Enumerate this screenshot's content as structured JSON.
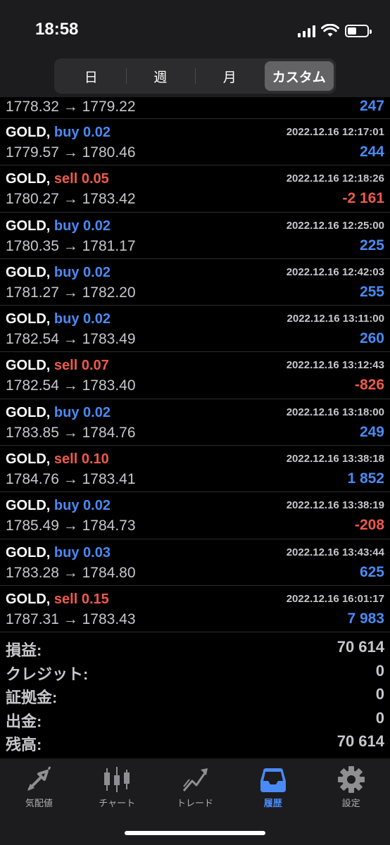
{
  "status_bar": {
    "time": "18:58"
  },
  "period_tabs": [
    "日",
    "週",
    "月",
    "カスタム"
  ],
  "trades": [
    {
      "symbol": "",
      "side": "",
      "volume": "",
      "time": "",
      "open": "1778.32",
      "close": "1779.22",
      "profit": "247",
      "profit_sign": "pos",
      "partial": true
    },
    {
      "symbol": "GOLD,",
      "side": "buy",
      "volume": "0.02",
      "time": "2022.12.16 12:17:01",
      "open": "1779.57",
      "close": "1780.46",
      "profit": "244",
      "profit_sign": "pos"
    },
    {
      "symbol": "GOLD,",
      "side": "sell",
      "volume": "0.05",
      "time": "2022.12.16 12:18:26",
      "open": "1780.27",
      "close": "1783.42",
      "profit": "-2 161",
      "profit_sign": "neg"
    },
    {
      "symbol": "GOLD,",
      "side": "buy",
      "volume": "0.02",
      "time": "2022.12.16 12:25:00",
      "open": "1780.35",
      "close": "1781.17",
      "profit": "225",
      "profit_sign": "pos"
    },
    {
      "symbol": "GOLD,",
      "side": "buy",
      "volume": "0.02",
      "time": "2022.12.16 12:42:03",
      "open": "1781.27",
      "close": "1782.20",
      "profit": "255",
      "profit_sign": "pos"
    },
    {
      "symbol": "GOLD,",
      "side": "buy",
      "volume": "0.02",
      "time": "2022.12.16 13:11:00",
      "open": "1782.54",
      "close": "1783.49",
      "profit": "260",
      "profit_sign": "pos"
    },
    {
      "symbol": "GOLD,",
      "side": "sell",
      "volume": "0.07",
      "time": "2022.12.16 13:12:43",
      "open": "1782.54",
      "close": "1783.40",
      "profit": "-826",
      "profit_sign": "neg"
    },
    {
      "symbol": "GOLD,",
      "side": "buy",
      "volume": "0.02",
      "time": "2022.12.16 13:18:00",
      "open": "1783.85",
      "close": "1784.76",
      "profit": "249",
      "profit_sign": "pos"
    },
    {
      "symbol": "GOLD,",
      "side": "sell",
      "volume": "0.10",
      "time": "2022.12.16 13:38:18",
      "open": "1784.76",
      "close": "1783.41",
      "profit": "1 852",
      "profit_sign": "pos"
    },
    {
      "symbol": "GOLD,",
      "side": "buy",
      "volume": "0.02",
      "time": "2022.12.16 13:38:19",
      "open": "1785.49",
      "close": "1784.73",
      "profit": "-208",
      "profit_sign": "neg"
    },
    {
      "symbol": "GOLD,",
      "side": "buy",
      "volume": "0.03",
      "time": "2022.12.16 13:43:44",
      "open": "1783.28",
      "close": "1784.80",
      "profit": "625",
      "profit_sign": "pos"
    },
    {
      "symbol": "GOLD,",
      "side": "sell",
      "volume": "0.15",
      "time": "2022.12.16 16:01:17",
      "open": "1787.31",
      "close": "1783.43",
      "profit": "7 983",
      "profit_sign": "pos"
    }
  ],
  "summary": [
    {
      "label": "損益:",
      "value": "70 614"
    },
    {
      "label": "クレジット:",
      "value": "0"
    },
    {
      "label": "証拠金:",
      "value": "0"
    },
    {
      "label": "出金:",
      "value": "0"
    },
    {
      "label": "残高:",
      "value": "70 614"
    }
  ],
  "tabbar": {
    "items": [
      {
        "label": "気配値",
        "icon": "quotes-arrows-icon"
      },
      {
        "label": "チャート",
        "icon": "candlestick-icon"
      },
      {
        "label": "トレード",
        "icon": "trade-chart-icon"
      },
      {
        "label": "履歴",
        "icon": "history-inbox-icon"
      },
      {
        "label": "設定",
        "icon": "gear-icon"
      }
    ],
    "active_index": 3
  },
  "colors": {
    "buy": "#4a8af4",
    "sell": "#ef5a4a",
    "accent": "#4a8af4"
  }
}
